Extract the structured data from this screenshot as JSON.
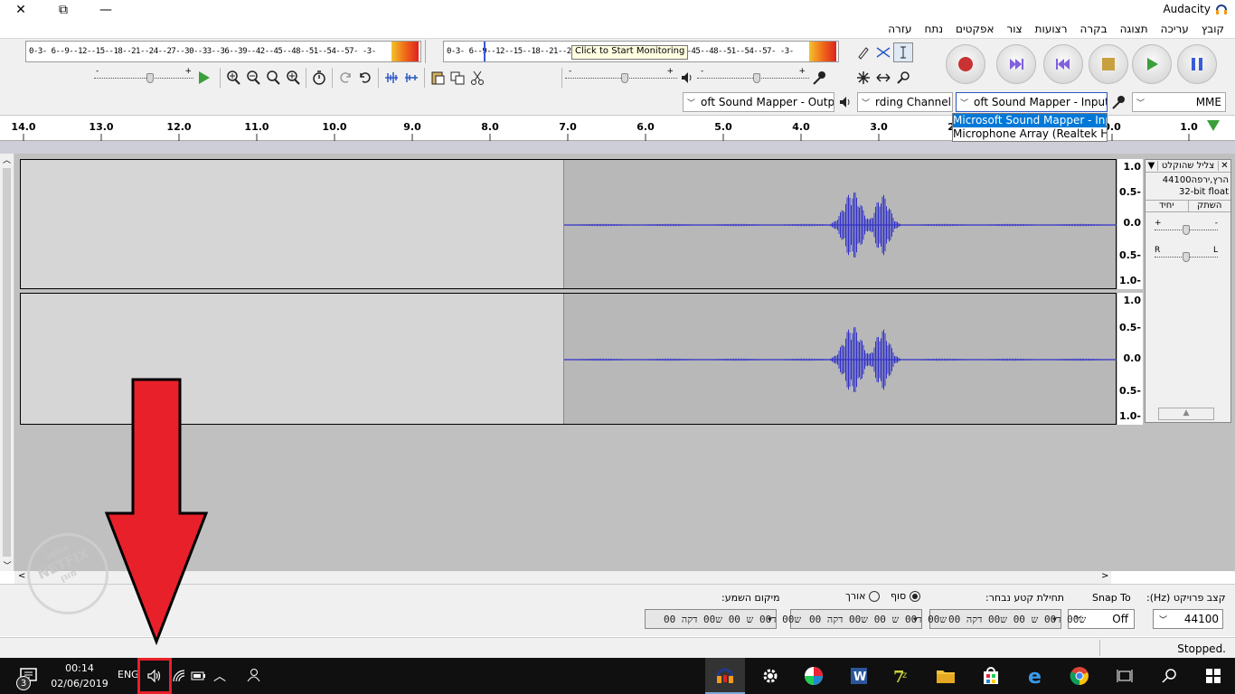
{
  "window": {
    "title": "Audacity",
    "minimize_glyph": "—",
    "restore_glyph": "⧉",
    "close_glyph": "✕"
  },
  "menu": [
    "קובץ",
    "עריכה",
    "תצוגה",
    "בקרה",
    "רצועות",
    "צור",
    "אפקטים",
    "נתח",
    "עזרה"
  ],
  "meters": {
    "record_scale": "0-3-  6--9--12--15--18--21--24--27--30--33--36--39--42--45--48--51--54--57-  -3-",
    "playback_scale": "0-3-  6--9--12--15--18--21--24--27--30--33--36--39--42--45--48--51--54--57-  -3-",
    "tooltip": "Click to Start Monitoring"
  },
  "device_toolbar": {
    "host": "MME",
    "input_device": "oft Sound Mapper - Input",
    "input_channels": "rding Channel 1",
    "output_device": "oft Sound Mapper - Output",
    "dropdown_options": [
      "Microsoft Sound Mapper - Input",
      "Microphone Array (Realtek High"
    ],
    "dropdown_selected": 0
  },
  "ruler": {
    "labels": [
      "1.0",
      "0.0",
      "1.0",
      "2.0",
      "3.0",
      "4.0",
      "5.0",
      "6.0",
      "7.0",
      "8.0",
      "9.0",
      "10.0",
      "11.0",
      "12.0",
      "13.0",
      "14.0"
    ],
    "label_suffix_rtl": "."
  },
  "track": {
    "name": "צליל שהוקלט",
    "rate_text": "44100הרץ,ירפה",
    "format_text": "32-bit float",
    "mute_label": "השתק",
    "solo_label": "יחיד",
    "gain_minus": "-",
    "gain_plus": "+",
    "pan_left": "L",
    "pan_right": "R",
    "collapse_glyph": "▲",
    "scale_labels": [
      "1.0",
      "0.5-",
      "0.0",
      "0.5-",
      "1.0-"
    ],
    "gain_level": 0.5,
    "pan_level": 0.5
  },
  "selection_bar": {
    "project_rate_label": "קצב פרויקט (Hz):",
    "project_rate_value": "44100",
    "snap_to_label": "Snap To",
    "snap_to_value": "Off",
    "selection_start_label": "תחילת קטע נבחר:",
    "end_radio_label": "סוף",
    "length_radio_label": "אורך",
    "audio_position_label": "מיקום השמע:",
    "time_value": "00 ש00 ד00 ש 00 ש00 דקה"
  },
  "status": {
    "text": "Stopped."
  },
  "taskbar": {
    "time": "00:14",
    "date": "02/06/2019",
    "language": "ENG",
    "notification_count": "3"
  },
  "overlay": {
    "watermark_lines": [
      "מחשב",
      "NETFIX",
      "מוגן"
    ],
    "arrow_color": "#e8202a",
    "highlight_color": "#e8202a"
  },
  "colors": {
    "waveform": "#3232c8",
    "track_bg": "#d6d6d6",
    "track_selected_bg": "#b8b8b8",
    "record_button": "#c83232",
    "play_button": "#3aa03a",
    "pause_button": "#3a5ad8",
    "skip_button": "#8060e0"
  }
}
